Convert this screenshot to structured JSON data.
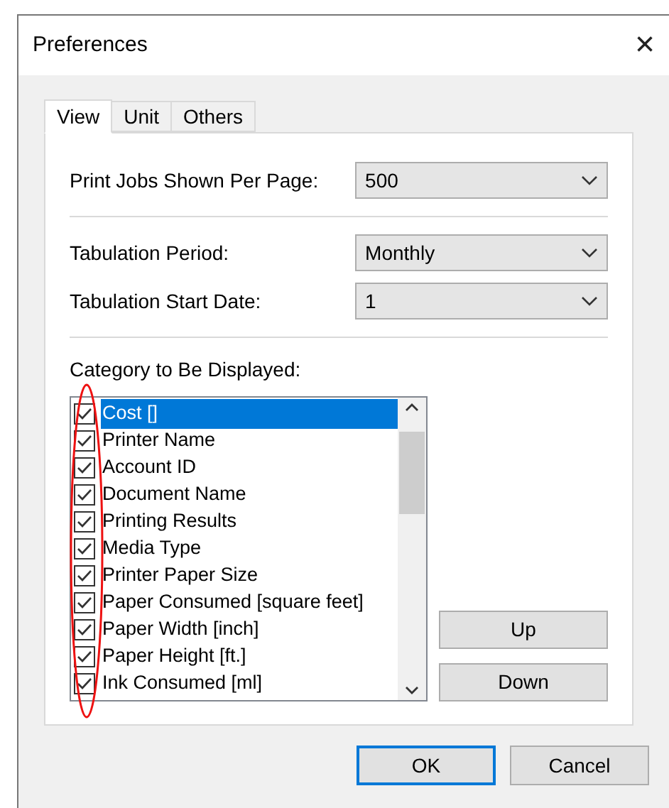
{
  "window": {
    "title": "Preferences",
    "close": "×"
  },
  "tabs": [
    {
      "label": "View",
      "selected": true
    },
    {
      "label": "Unit",
      "selected": false
    },
    {
      "label": "Others",
      "selected": false
    }
  ],
  "settings": [
    {
      "label": "Print Jobs Shown Per Page:",
      "value": "500"
    },
    {
      "label": "Tabulation Period:",
      "value": "Monthly"
    },
    {
      "label": "Tabulation Start Date:",
      "value": "1"
    }
  ],
  "category": {
    "label": "Category to Be Displayed:",
    "items": [
      {
        "label": "Cost []",
        "checked": true,
        "selected": true
      },
      {
        "label": "Printer Name",
        "checked": true,
        "selected": false
      },
      {
        "label": "Account ID",
        "checked": true,
        "selected": false
      },
      {
        "label": "Document Name",
        "checked": true,
        "selected": false
      },
      {
        "label": "Printing Results",
        "checked": true,
        "selected": false
      },
      {
        "label": "Media Type",
        "checked": true,
        "selected": false
      },
      {
        "label": "Printer Paper Size",
        "checked": true,
        "selected": false
      },
      {
        "label": "Paper Consumed [square feet]",
        "checked": true,
        "selected": false
      },
      {
        "label": "Paper Width [inch]",
        "checked": true,
        "selected": false
      },
      {
        "label": "Paper Height [ft.]",
        "checked": true,
        "selected": false
      },
      {
        "label": "Ink Consumed [ml]",
        "checked": true,
        "selected": false
      }
    ]
  },
  "move_buttons": [
    "Up",
    "Down"
  ],
  "buttons": [
    {
      "label": "OK",
      "default": true
    },
    {
      "label": "Cancel",
      "default": false
    }
  ]
}
